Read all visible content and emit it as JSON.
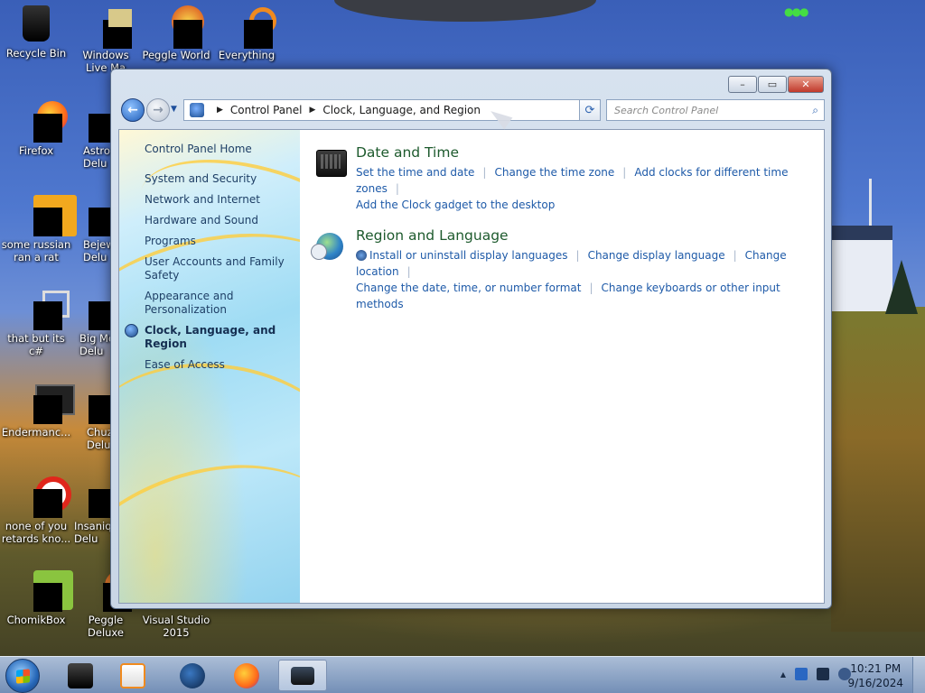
{
  "desktop": {
    "icons": [
      {
        "label": "Recycle Bin"
      },
      {
        "label": "Windows Live Ma"
      },
      {
        "label": "Peggle World"
      },
      {
        "label": "Everything"
      },
      {
        "label": "Firefox"
      },
      {
        "label": "Astro Delu"
      },
      {
        "label": "some russian ran a rat"
      },
      {
        "label": "Bejew Delu"
      },
      {
        "label": "that but its c#"
      },
      {
        "label": "Big Mo Delu"
      },
      {
        "label": "Endermanc..."
      },
      {
        "label": "Chuz Delu"
      },
      {
        "label": "none of you retards kno..."
      },
      {
        "label": "Insaniq Delu"
      },
      {
        "label": "ChomikBox"
      },
      {
        "label": "Peggle Deluxe"
      },
      {
        "label": "Visual Studio 2015"
      }
    ]
  },
  "window": {
    "controls": {
      "minimize": "–",
      "maximize": "▭",
      "close": "✕"
    },
    "address": {
      "crumbs": [
        "Control Panel",
        "Clock, Language, and Region"
      ]
    },
    "search": {
      "placeholder": "Search Control Panel"
    },
    "sidebar": {
      "home": "Control Panel Home",
      "items": [
        "System and Security",
        "Network and Internet",
        "Hardware and Sound",
        "Programs",
        "User Accounts and Family Safety",
        "Appearance and Personalization",
        "Clock, Language, and Region",
        "Ease of Access"
      ],
      "active_index": 6
    },
    "categories": [
      {
        "title": "Date and Time",
        "icon": "clock-keyboard-icon",
        "links_row1": [
          "Set the time and date",
          "Change the time zone",
          "Add clocks for different time zones"
        ],
        "links_row2": [
          "Add the Clock gadget to the desktop"
        ]
      },
      {
        "title": "Region and Language",
        "icon": "globe-icon",
        "links_row1": [
          "Install or uninstall display languages",
          "Change display language",
          "Change location"
        ],
        "links_row2": [
          "Change the date, time, or number format",
          "Change keyboards or other input methods"
        ]
      }
    ]
  },
  "taskbar": {
    "clock_time": "10:21 PM",
    "clock_date": "9/16/2024",
    "tray_arrow": "▲"
  }
}
